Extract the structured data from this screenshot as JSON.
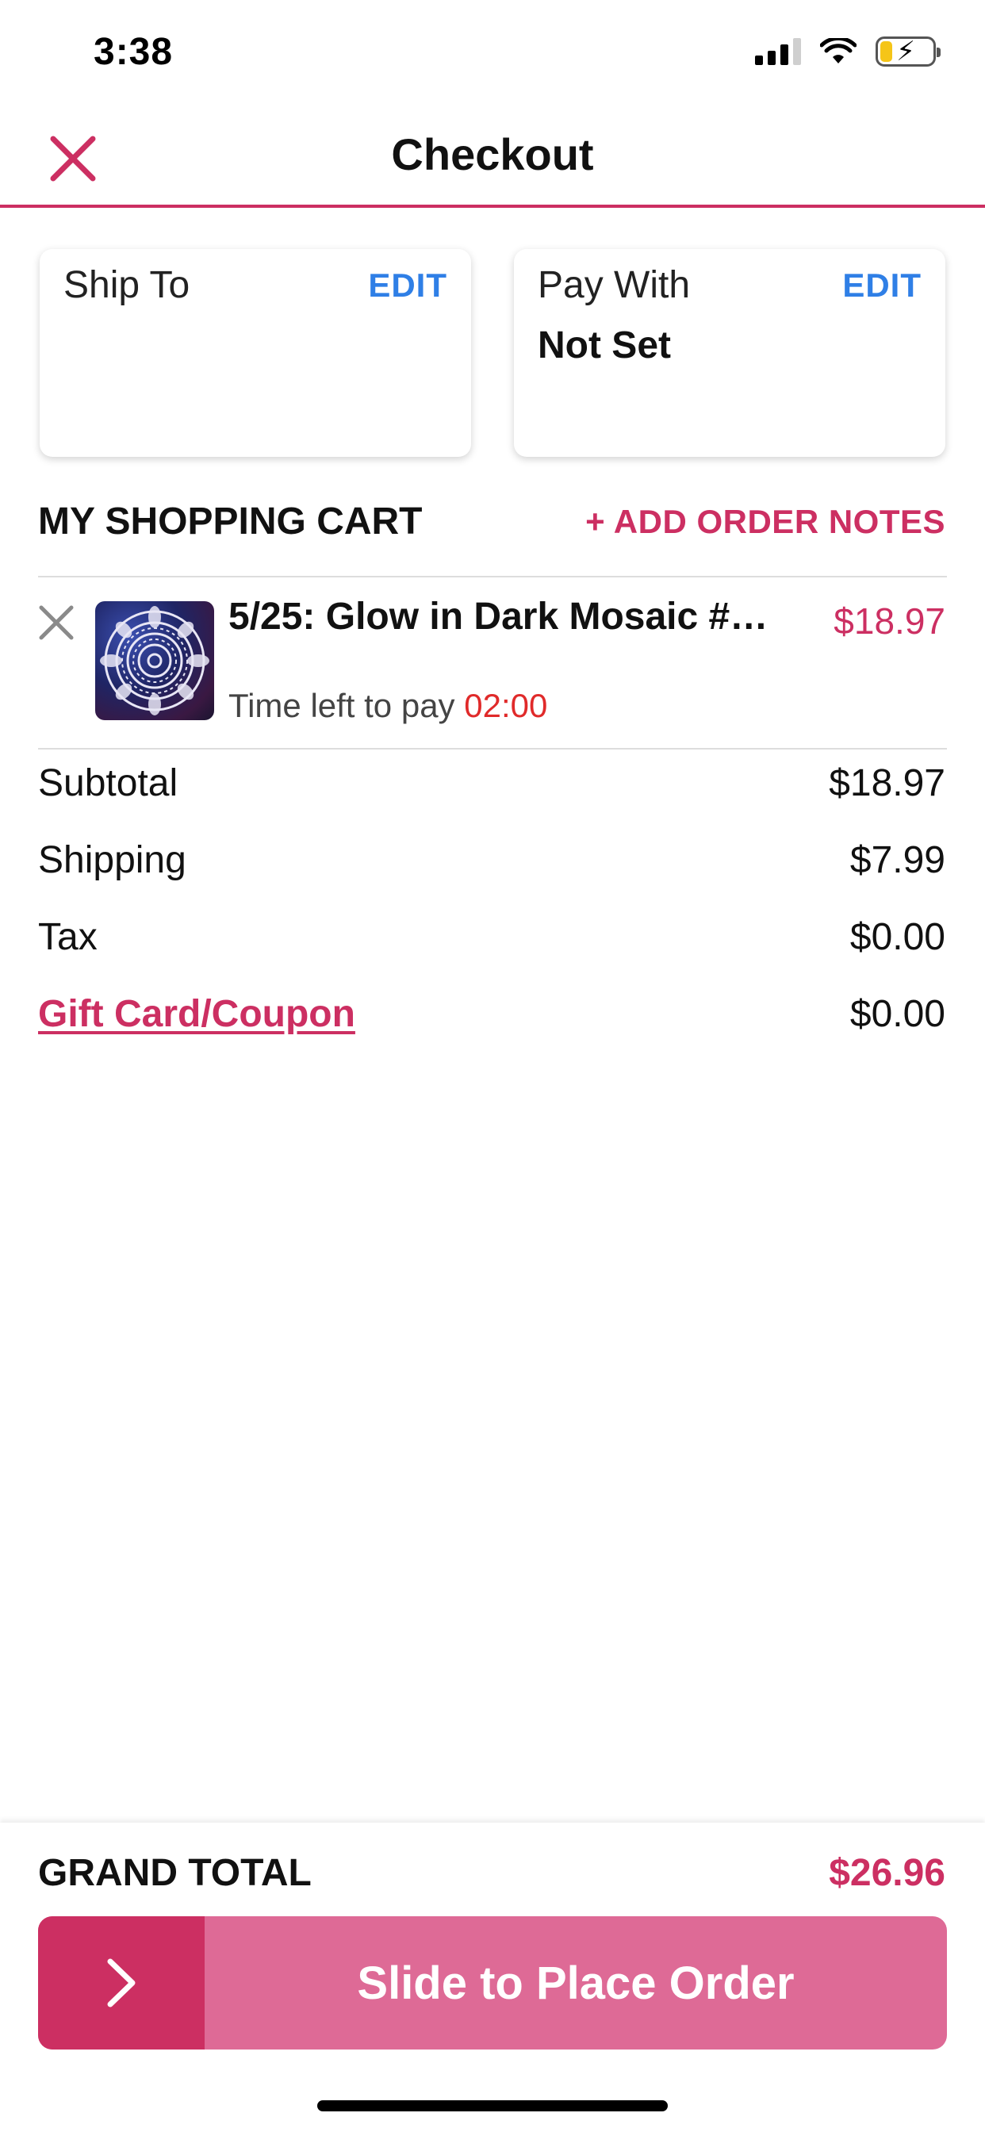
{
  "status_bar": {
    "time": "3:38"
  },
  "header": {
    "title": "Checkout"
  },
  "ship_to": {
    "label": "Ship To",
    "edit_label": "EDIT",
    "value": ""
  },
  "pay_with": {
    "label": "Pay With",
    "edit_label": "EDIT",
    "value": "Not Set"
  },
  "cart": {
    "title": "MY SHOPPING CART",
    "add_notes_label": "+ ADD ORDER NOTES",
    "items": [
      {
        "name": "5/25: Glow in Dark Mosaic #…",
        "price": "$18.97",
        "time_left_label": "Time left to pay",
        "countdown": "02:00"
      }
    ]
  },
  "summary": [
    {
      "label": "Subtotal",
      "value": "$18.97"
    },
    {
      "label": "Shipping",
      "value": "$7.99"
    },
    {
      "label": "Tax",
      "value": "$0.00"
    },
    {
      "label": "Gift Card/Coupon",
      "value": "$0.00"
    }
  ],
  "grand_total": {
    "label": "GRAND TOTAL",
    "value": "$26.96"
  },
  "slider": {
    "label": "Slide to Place Order",
    "icon": "chevron-right-icon"
  },
  "colors": {
    "accent": "#cc2f62",
    "link_blue": "#2f7fe6",
    "slider_track": "#de6a96",
    "countdown": "#e02a2a"
  }
}
